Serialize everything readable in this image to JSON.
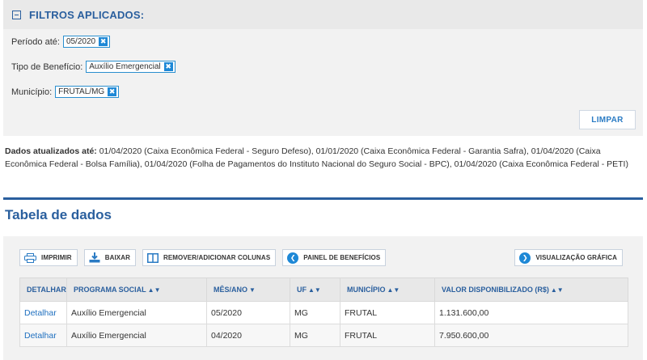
{
  "filters": {
    "title": "FILTROS APLICADOS:",
    "items": [
      {
        "label": "Período até:",
        "value": "05/2020"
      },
      {
        "label": "Tipo de Benefício:",
        "value": "Auxílio Emergencial"
      },
      {
        "label": "Município:",
        "value": "FRUTAL/MG"
      }
    ],
    "remove_glyph": "✖",
    "clear_label": "LIMPAR"
  },
  "updated": {
    "label": "Dados atualizados até:",
    "text": " 01/04/2020 (Caixa Econômica Federal - Seguro Defeso), 01/01/2020 (Caixa Econômica Federal - Garantia Safra), 01/04/2020 (Caixa Econômica Federal - Bolsa Família), 01/04/2020 (Folha de Pagamentos do Instituto Nacional do Seguro Social - BPC), 01/04/2020 (Caixa Econômica Federal - PETI)"
  },
  "section_title": "Tabela de dados",
  "toolbar": {
    "print_label": "IMPRIMIR",
    "download_label": "BAIXAR",
    "columns_label": "REMOVER/ADICIONAR COLUNAS",
    "panel_label": "PAINEL DE BENEFÍCIOS",
    "chart_view_label": "VISUALIZAÇÃO GRÁFICA"
  },
  "table": {
    "headers": [
      "DETALHAR",
      "PROGRAMA SOCIAL",
      "MÊS/ANO",
      "UF",
      "MUNICÍPIO",
      "VALOR DISPONIBILIZADO (R$)"
    ],
    "rows": [
      {
        "detail": "Detalhar",
        "program": "Auxílio Emergencial",
        "month": "05/2020",
        "uf": "MG",
        "city": "FRUTAL",
        "value": "1.131.600,00"
      },
      {
        "detail": "Detalhar",
        "program": "Auxílio Emergencial",
        "month": "04/2020",
        "uf": "MG",
        "city": "FRUTAL",
        "value": "7.950.600,00"
      }
    ]
  },
  "colors": {
    "accent": "#2a5f9e",
    "chip_border": "#2a8fcf",
    "link": "#1e6fbf"
  }
}
